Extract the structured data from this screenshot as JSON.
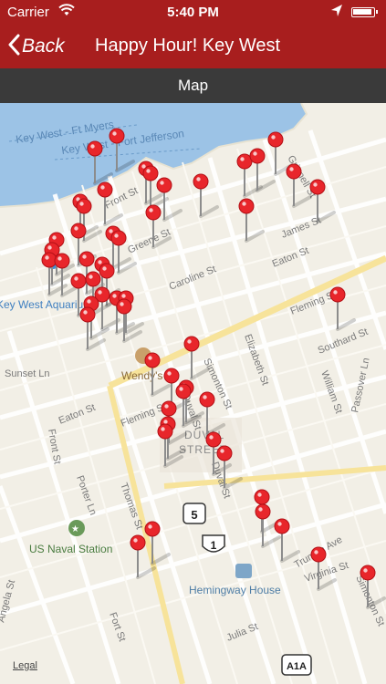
{
  "status_bar": {
    "carrier": "Carrier",
    "time": "5:40 PM"
  },
  "nav": {
    "back_label": "Back",
    "title": "Happy Hour! Key West"
  },
  "subbar": {
    "label": "Map"
  },
  "map": {
    "water_labels": [
      "Key West - Ft Myers",
      "Key West - Fort Jefferson"
    ],
    "street_labels": [
      "Front St",
      "Greene St",
      "Caroline St",
      "Eaton St",
      "James St",
      "Grinnell St",
      "Fleming St",
      "Southard St",
      "Elizabeth St",
      "William St",
      "Passover Ln",
      "Sunset Ln",
      "Eaton St",
      "Fleming St",
      "Simonton St",
      "Duval St",
      "Duval St",
      "Front St",
      "Porter Ln",
      "Thomas St",
      "Truman Ave",
      "Virginia St",
      "Simonton St",
      "Fort St",
      "Julia St",
      "Angela St"
    ],
    "district_label": "DUVAL STREET",
    "pois": {
      "aquarium": "Key West Aquarium",
      "naval": "US Naval Station",
      "wendys": "Wendy's",
      "hemingway": "Hemingway House"
    },
    "route_shields": [
      "5",
      "1",
      "A1A"
    ],
    "legal": "Legal"
  },
  "colors": {
    "brand": "#a81e1e",
    "subbar": "#3a3a3a",
    "pin": "#e8262b",
    "water": "#9cc3e6"
  }
}
